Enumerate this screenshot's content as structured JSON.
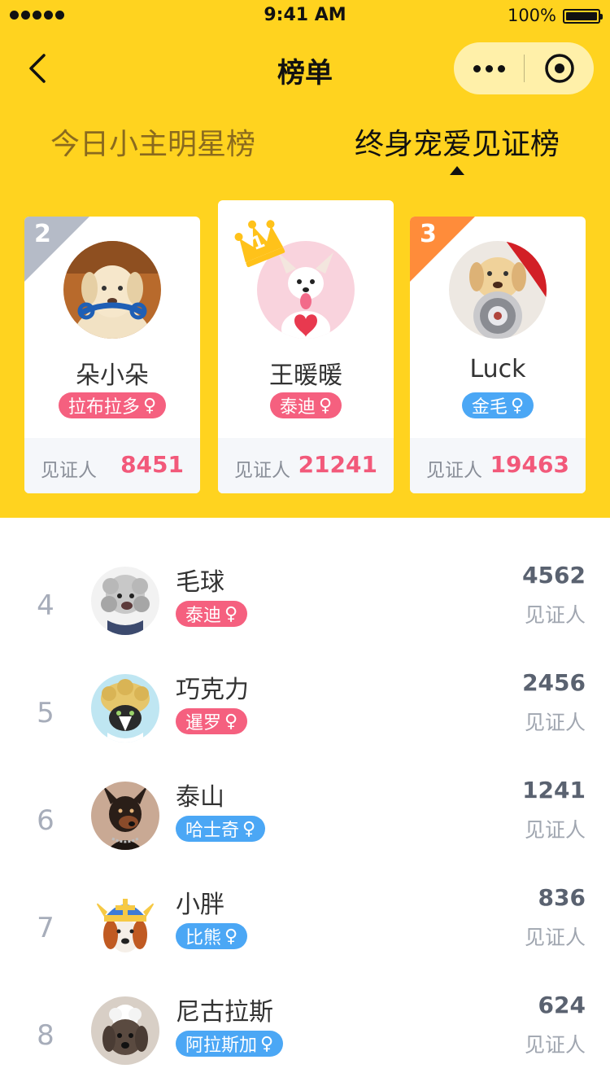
{
  "status": {
    "time": "9:41 AM",
    "battery": "100%"
  },
  "nav": {
    "title": "榜单"
  },
  "tabs": [
    {
      "label": "今日小主明星榜",
      "active": false
    },
    {
      "label": "终身宠爱见证榜",
      "active": true
    }
  ],
  "podium": {
    "witness_label": "见证人",
    "second": {
      "rank": "2",
      "name": "朵小朵",
      "breed": "拉布拉多",
      "gender": "♀",
      "count": "8451"
    },
    "first": {
      "rank": "1",
      "name": "王暖暖",
      "breed": "泰迪",
      "gender": "♀",
      "count": "21241"
    },
    "third": {
      "rank": "3",
      "name": "Luck",
      "breed": "金毛",
      "gender": "♀",
      "count": "19463"
    }
  },
  "list": [
    {
      "rank": "4",
      "name": "毛球",
      "breed": "泰迪",
      "gender": "♀",
      "tag_color": "pink",
      "count": "4562",
      "label": "见证人"
    },
    {
      "rank": "5",
      "name": "巧克力",
      "breed": "暹罗",
      "gender": "♀",
      "tag_color": "pink",
      "count": "2456",
      "label": "见证人"
    },
    {
      "rank": "6",
      "name": "泰山",
      "breed": "哈士奇",
      "gender": "♀",
      "tag_color": "blue",
      "count": "1241",
      "label": "见证人"
    },
    {
      "rank": "7",
      "name": "小胖",
      "breed": "比熊",
      "gender": "♀",
      "tag_color": "blue",
      "count": "836",
      "label": "见证人"
    },
    {
      "rank": "8",
      "name": "尼古拉斯",
      "breed": "阿拉斯加",
      "gender": "♀",
      "tag_color": "blue",
      "count": "624",
      "label": "见证人"
    }
  ],
  "colors": {
    "header_bg": "#FFD31F",
    "count_pink": "#F2597A",
    "tag_pink": "#F5607F",
    "tag_blue": "#4BA7F5",
    "rank_gold": "#FFC21A",
    "rank_silver": "#B5BBC7",
    "rank_bronze": "#FF8C3A"
  },
  "icons": [
    "back-arrow-icon",
    "more-dots-icon",
    "target-icon",
    "crown-icon",
    "female-icon"
  ]
}
